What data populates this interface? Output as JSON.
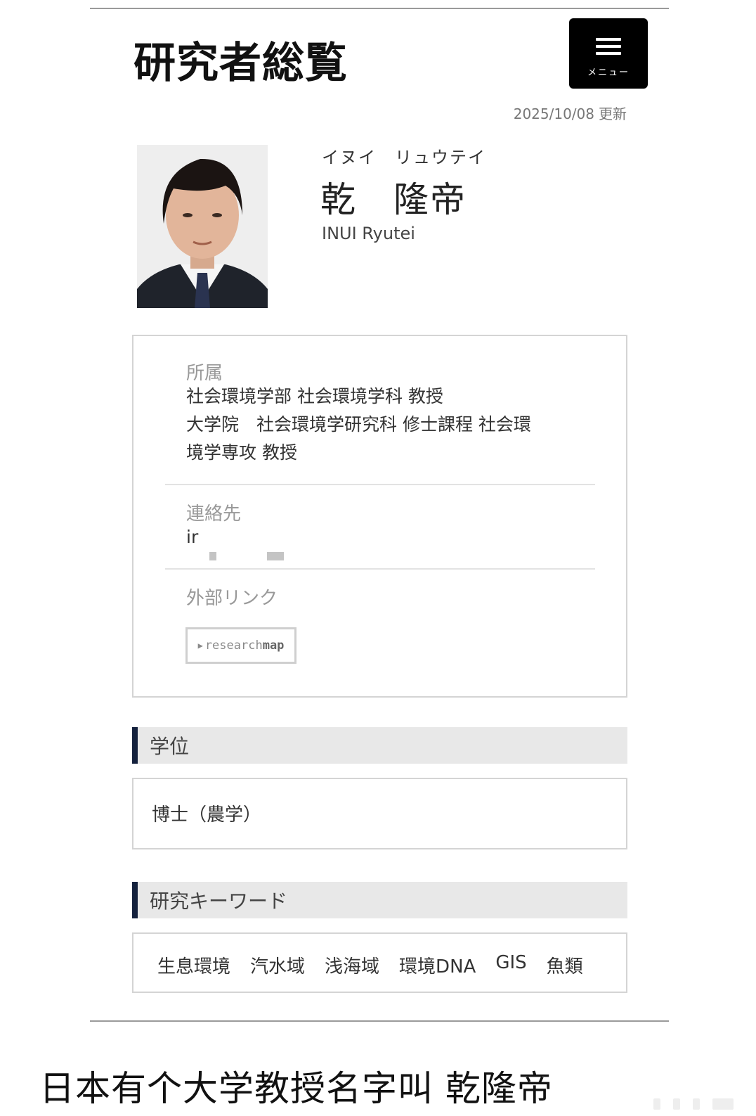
{
  "header": {
    "site_title": "研究者総覧",
    "menu_label": "メニュー",
    "updated_date": "2025/10/08",
    "updated_suffix": "更新"
  },
  "profile": {
    "name_kana": "イヌイ　リュウテイ",
    "name_kanji": "乾　隆帝",
    "name_roman": "INUI Ryutei"
  },
  "info": {
    "affiliation_label": "所属",
    "affiliation_lines": [
      "社会環境学部 社会環境学科 教授",
      "大学院　社会環境学研究科 修士課程 社会環",
      "境学専攻 教授"
    ],
    "contact_label": "連絡先",
    "contact_value": "ir",
    "external_links_label": "外部リンク",
    "researchmap_prefix": "research",
    "researchmap_suffix": "map"
  },
  "degree": {
    "heading": "学位",
    "value": "博士（農学）"
  },
  "keywords": {
    "heading": "研究キーワード",
    "items": [
      "生息環境",
      "汽水域",
      "浅海域",
      "環境DNA",
      "GIS",
      "魚類"
    ]
  },
  "caption": "日本有个大学教授名字叫 乾隆帝",
  "icons": {
    "menu": "hamburger-icon",
    "link_arrow": "play-triangle-icon"
  },
  "colors": {
    "section_accent": "#14213d",
    "section_bg": "#e8e8e8",
    "menu_bg": "#000000"
  }
}
